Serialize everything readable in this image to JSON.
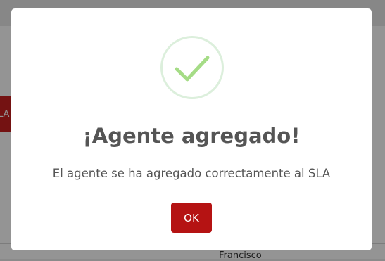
{
  "background": {
    "sla_button_label": "LA",
    "table_cell_name": "Francisco"
  },
  "dialog": {
    "icon": "success-checkmark-icon",
    "title": "¡Agente agregado!",
    "message": "El agente se ha agregado correctamente al SLA",
    "ok_label": "OK"
  },
  "colors": {
    "accent_red": "#b51313",
    "success_green": "#a5dc86",
    "text": "#555555"
  }
}
